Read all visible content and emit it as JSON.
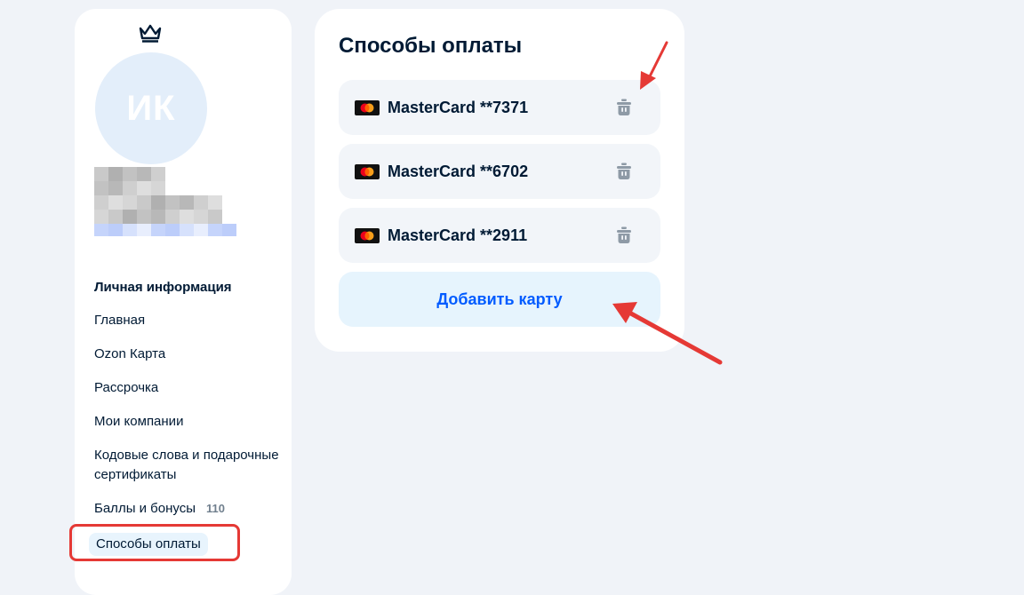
{
  "profile": {
    "initials": "ИК"
  },
  "nav": {
    "heading": "Личная информация",
    "items": [
      {
        "label": "Главная"
      },
      {
        "label": "Ozon Карта"
      },
      {
        "label": "Рассрочка"
      },
      {
        "label": "Мои компании"
      },
      {
        "label": "Кодовые слова и подарочные сертификаты"
      },
      {
        "label": "Баллы и бонусы",
        "badge": "110"
      },
      {
        "label": "Способы оплаты",
        "active": true
      }
    ]
  },
  "payment": {
    "title": "Способы оплаты",
    "cards": [
      {
        "label": "MasterCard **7371",
        "icon": "mastercard-icon"
      },
      {
        "label": "MasterCard **6702",
        "icon": "mastercard-icon"
      },
      {
        "label": "MasterCard **2911",
        "icon": "mastercard-icon"
      }
    ],
    "add_button_label": "Добавить карту"
  },
  "colors": {
    "page_background": "#f0f3f8",
    "accent_blue": "#005bff",
    "annotation_red": "#e53935",
    "add_button_bg": "#e6f4fd"
  }
}
